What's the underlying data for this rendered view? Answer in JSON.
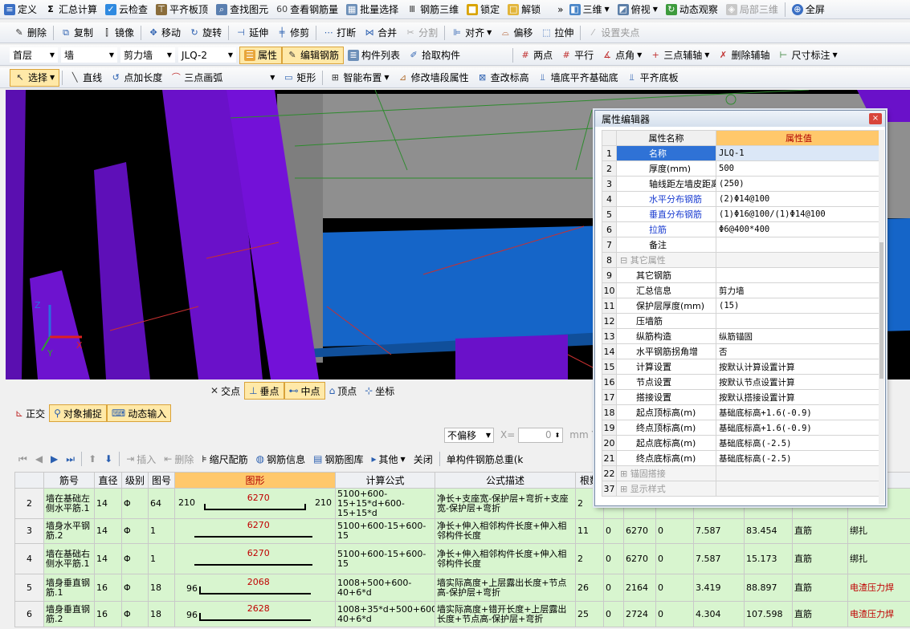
{
  "toolbar1": {
    "items": [
      "定义",
      "汇总计算",
      "云检查",
      "平齐板顶",
      "查找图元",
      "查看钢筋量",
      "批量选择",
      "钢筋三维",
      "锁定",
      "解锁",
      "三维",
      "俯视",
      "动态观察",
      "局部三维",
      "全屏"
    ]
  },
  "toolbar2": {
    "items": [
      "删除",
      "复制",
      "镜像",
      "移动",
      "旋转",
      "延伸",
      "修剪",
      "打断",
      "合并",
      "分割",
      "对齐",
      "偏移",
      "拉伸",
      "设置夹点"
    ]
  },
  "toolbar3": {
    "floor": "首层",
    "type": "墙",
    "subtype": "剪力墙",
    "component": "JLQ-2",
    "items": [
      "属性",
      "编辑钢筋",
      "构件列表",
      "拾取构件",
      "两点",
      "平行",
      "点角",
      "三点辅轴",
      "删除辅轴",
      "尺寸标注"
    ]
  },
  "toolbar4": {
    "items": [
      "选择",
      "直线",
      "点加长度",
      "三点画弧",
      "矩形",
      "智能布置",
      "修改墙段属性",
      "查改标高",
      "墙底平齐基础底",
      "平齐底板"
    ]
  },
  "snap": {
    "items": [
      "交点",
      "垂点",
      "中点",
      "顶点",
      "坐标"
    ]
  },
  "snap2": {
    "items": [
      "正交",
      "对象捕捉",
      "动态输入"
    ]
  },
  "offset": {
    "mode": "不偏移",
    "x_label": "X=",
    "x_value": "0",
    "unit": "mm",
    "y_label": "Y="
  },
  "gridbar": {
    "items": [
      "插入",
      "删除",
      "缩尺配筋",
      "钢筋信息",
      "钢筋图库",
      "其他",
      "关闭",
      "单构件钢筋总重(k"
    ]
  },
  "axis": {
    "x": "X",
    "y": "Y",
    "z": "Z"
  },
  "prop_editor": {
    "title": "属性编辑器",
    "col_name": "属性名称",
    "col_value": "属性值",
    "rows": [
      {
        "n": "1",
        "k": "名称",
        "v": "JLQ-1",
        "blue": true,
        "sel": true
      },
      {
        "n": "2",
        "k": "厚度(mm)",
        "v": "500"
      },
      {
        "n": "3",
        "k": "轴线距左墙皮距离",
        "v": "(250)"
      },
      {
        "n": "4",
        "k": "水平分布钢筋",
        "v": "(2)Φ14@100",
        "blue": true
      },
      {
        "n": "5",
        "k": "垂直分布钢筋",
        "v": "(1)Φ16@100/(1)Φ14@100",
        "blue": true
      },
      {
        "n": "6",
        "k": "拉筋",
        "v": "Φ6@400*400",
        "blue": true
      },
      {
        "n": "7",
        "k": "备注",
        "v": ""
      },
      {
        "n": "8",
        "k": "其它属性",
        "v": "",
        "group": "−"
      },
      {
        "n": "9",
        "k": "其它钢筋",
        "v": "",
        "child": true
      },
      {
        "n": "10",
        "k": "汇总信息",
        "v": "剪力墙",
        "child": true
      },
      {
        "n": "11",
        "k": "保护层厚度(mm)",
        "v": "(15)",
        "child": true
      },
      {
        "n": "12",
        "k": "压墙筋",
        "v": "",
        "child": true
      },
      {
        "n": "13",
        "k": "纵筋构造",
        "v": "纵筋锚固",
        "child": true
      },
      {
        "n": "14",
        "k": "水平钢筋拐角增",
        "v": "否",
        "child": true
      },
      {
        "n": "15",
        "k": "计算设置",
        "v": "按默认计算设置计算",
        "child": true
      },
      {
        "n": "16",
        "k": "节点设置",
        "v": "按默认节点设置计算",
        "child": true
      },
      {
        "n": "17",
        "k": "搭接设置",
        "v": "按默认搭接设置计算",
        "child": true
      },
      {
        "n": "18",
        "k": "起点顶标高(m)",
        "v": "基础底标高+1.6(-0.9)",
        "child": true
      },
      {
        "n": "19",
        "k": "终点顶标高(m)",
        "v": "基础底标高+1.6(-0.9)",
        "child": true
      },
      {
        "n": "20",
        "k": "起点底标高(m)",
        "v": "基础底标高(-2.5)",
        "child": true
      },
      {
        "n": "21",
        "k": "终点底标高(m)",
        "v": "基础底标高(-2.5)",
        "child": true
      },
      {
        "n": "22",
        "k": "锚固搭接",
        "v": "",
        "group": "+"
      },
      {
        "n": "37",
        "k": "显示样式",
        "v": "",
        "group": "+"
      }
    ]
  },
  "grid": {
    "headers": [
      "筋号",
      "直径",
      "级别",
      "图号",
      "图形",
      "计算公式",
      "公式描述",
      "根数",
      "",
      "",
      "",
      "",
      "",
      "",
      "式"
    ],
    "rows": [
      {
        "n": "2",
        "name": "墙在基础左侧水平筋.1",
        "dia": "14",
        "grade": "Φ",
        "fig": "64",
        "shape": "hook",
        "l": "210",
        "m": "6270",
        "r": "210",
        "formula": "5100+600-15+15*d+600-15+15*d",
        "desc": "净长+支座宽-保护层+弯折+支座宽-保护层+弯折",
        "count": "2",
        "c1": "",
        "c2": "",
        "c3": "",
        "c4": "",
        "c5": "",
        "type": "",
        "join": ""
      },
      {
        "n": "3",
        "name": "墙身水平钢筋.2",
        "dia": "14",
        "grade": "Φ",
        "fig": "1",
        "shape": "flat",
        "l": "",
        "m": "6270",
        "r": "",
        "formula": "5100+600-15+600-15",
        "desc": "净长+伸入相邻构件长度+伸入相邻构件长度",
        "count": "11",
        "c1": "0",
        "c2": "6270",
        "c3": "0",
        "c4": "7.587",
        "c5": "83.454",
        "type": "直筋",
        "join": "绑扎"
      },
      {
        "n": "4",
        "name": "墙在基础右侧水平筋.1",
        "dia": "14",
        "grade": "Φ",
        "fig": "1",
        "shape": "flat",
        "l": "",
        "m": "6270",
        "r": "",
        "formula": "5100+600-15+600-15",
        "desc": "净长+伸入相邻构件长度+伸入相邻构件长度",
        "count": "2",
        "c1": "0",
        "c2": "6270",
        "c3": "0",
        "c4": "7.587",
        "c5": "15.173",
        "type": "直筋",
        "join": "绑扎"
      },
      {
        "n": "5",
        "name": "墙身垂直钢筋.1",
        "dia": "16",
        "grade": "Φ",
        "fig": "18",
        "shape": "L",
        "l": "96",
        "m": "2068",
        "r": "",
        "formula": "1008+500+600-40+6*d",
        "desc": "墙实际高度+上层露出长度+节点高-保护层+弯折",
        "count": "26",
        "c1": "0",
        "c2": "2164",
        "c3": "0",
        "c4": "3.419",
        "c5": "88.897",
        "type": "直筋",
        "join": "电渣压力焊"
      },
      {
        "n": "6",
        "name": "墙身垂直钢筋.2",
        "dia": "16",
        "grade": "Φ",
        "fig": "18",
        "shape": "L",
        "l": "96",
        "m": "2628",
        "r": "",
        "formula": "1008+35*d+500+600-40+6*d",
        "desc": "墙实际高度+错开长度+上层露出长度+节点高-保护层+弯折",
        "count": "25",
        "c1": "0",
        "c2": "2724",
        "c3": "0",
        "c4": "4.304",
        "c5": "107.598",
        "type": "直筋",
        "join": "电渣压力焊"
      }
    ]
  }
}
